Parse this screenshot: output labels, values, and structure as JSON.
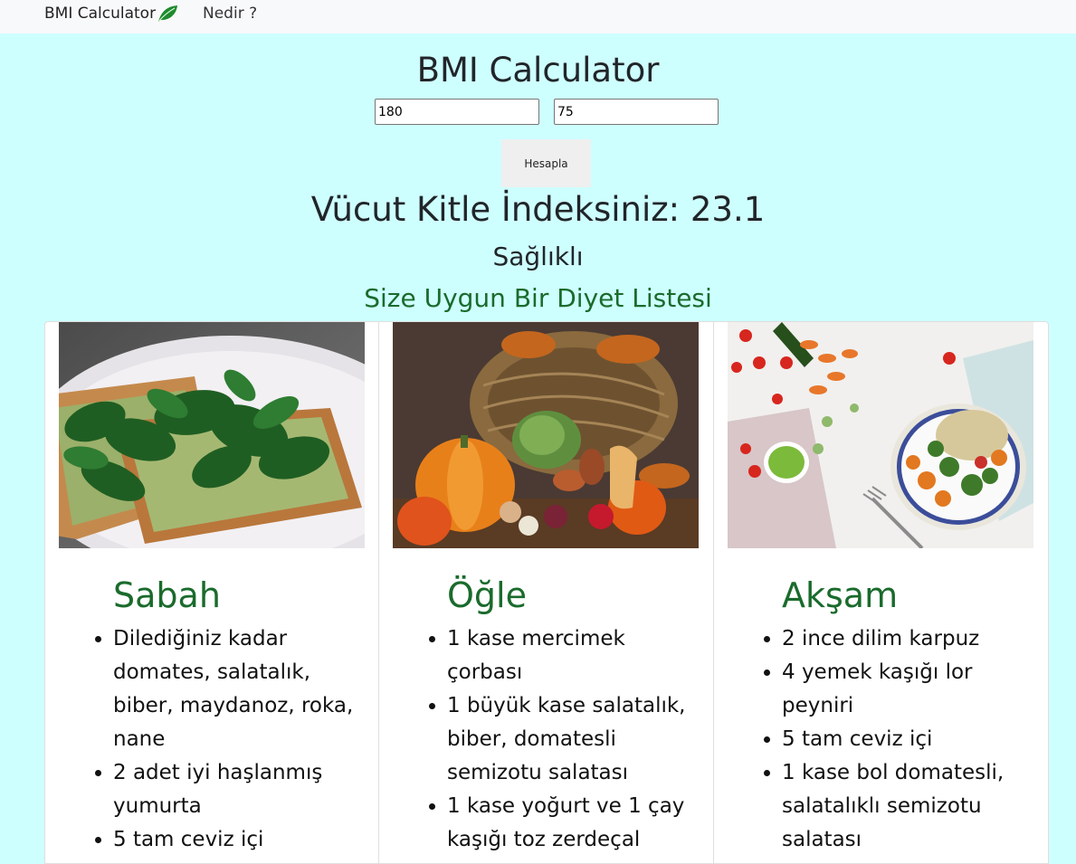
{
  "navbar": {
    "brand": "BMI Calculator",
    "link": "Nedir ?"
  },
  "form": {
    "title": "BMI Calculator",
    "height_value": "180",
    "weight_value": "75",
    "button_label": "Hesapla"
  },
  "result": {
    "text": "Vücut Kitle İndeksiniz: 23.1",
    "status": "Sağlıklı",
    "diet_title": "Size Uygun Bir Diyet Listesi"
  },
  "cards": [
    {
      "title": "Sabah",
      "items": [
        "Dilediğiniz kadar domates, salatalık, biber, maydanoz, roka, nane",
        "2 adet iyi haşlanmış yumurta",
        "5 tam ceviz içi"
      ]
    },
    {
      "title": "Öğle",
      "items": [
        "1 kase mercimek çorbası",
        "1 büyük kase salatalık, biber, domatesli semizotu salatası",
        "1 kase yoğurt ve 1 çay kaşığı toz zerdeçal"
      ]
    },
    {
      "title": "Akşam",
      "items": [
        "2 ince dilim karpuz",
        "4 yemek kaşığı lor peyniri",
        "5 tam ceviz içi",
        "1 kase bol domatesli, salatalıklı semizotu salatası"
      ]
    }
  ]
}
